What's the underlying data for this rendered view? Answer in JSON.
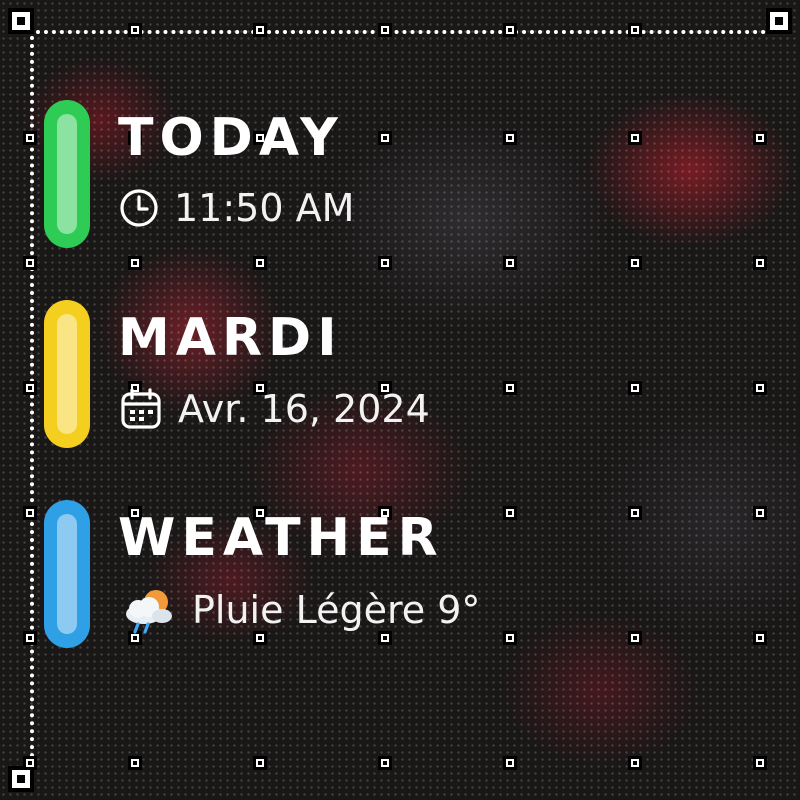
{
  "widgets": {
    "today": {
      "title": "TODAY",
      "value": "11:50 AM",
      "icon": "clock-icon",
      "accent": "#2ecc55"
    },
    "date": {
      "title": "MARDI",
      "value": "Avr. 16, 2024",
      "icon": "calendar-icon",
      "accent": "#f5cf1f"
    },
    "weather": {
      "title": "WEATHER",
      "value": "Pluie Légère 9°",
      "icon": "rain-cloud-sun-icon",
      "accent": "#2f9fe6"
    }
  },
  "colors": {
    "text": "#ffffff",
    "background": "#1a1717",
    "flower_accent": "#b8262f"
  }
}
